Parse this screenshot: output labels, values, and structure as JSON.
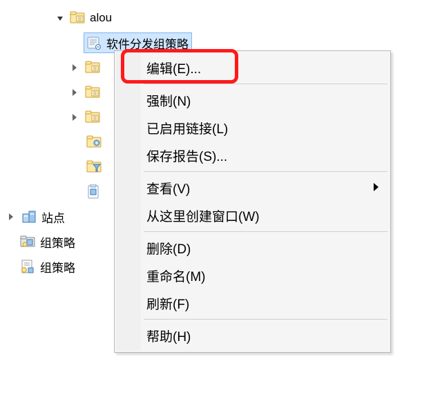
{
  "tree": {
    "alou": "alou",
    "selected_policy": "软件分发组策略",
    "site": "站点",
    "gp1": "组策略",
    "gp2": "组策略"
  },
  "menu": {
    "edit": "编辑(E)...",
    "force": "强制(N)",
    "enabled_link": "已启用链接(L)",
    "save_report": "保存报告(S)...",
    "view": "查看(V)",
    "new_window": "从这里创建窗口(W)",
    "delete": "删除(D)",
    "rename": "重命名(M)",
    "refresh": "刷新(F)",
    "help": "帮助(H)"
  }
}
